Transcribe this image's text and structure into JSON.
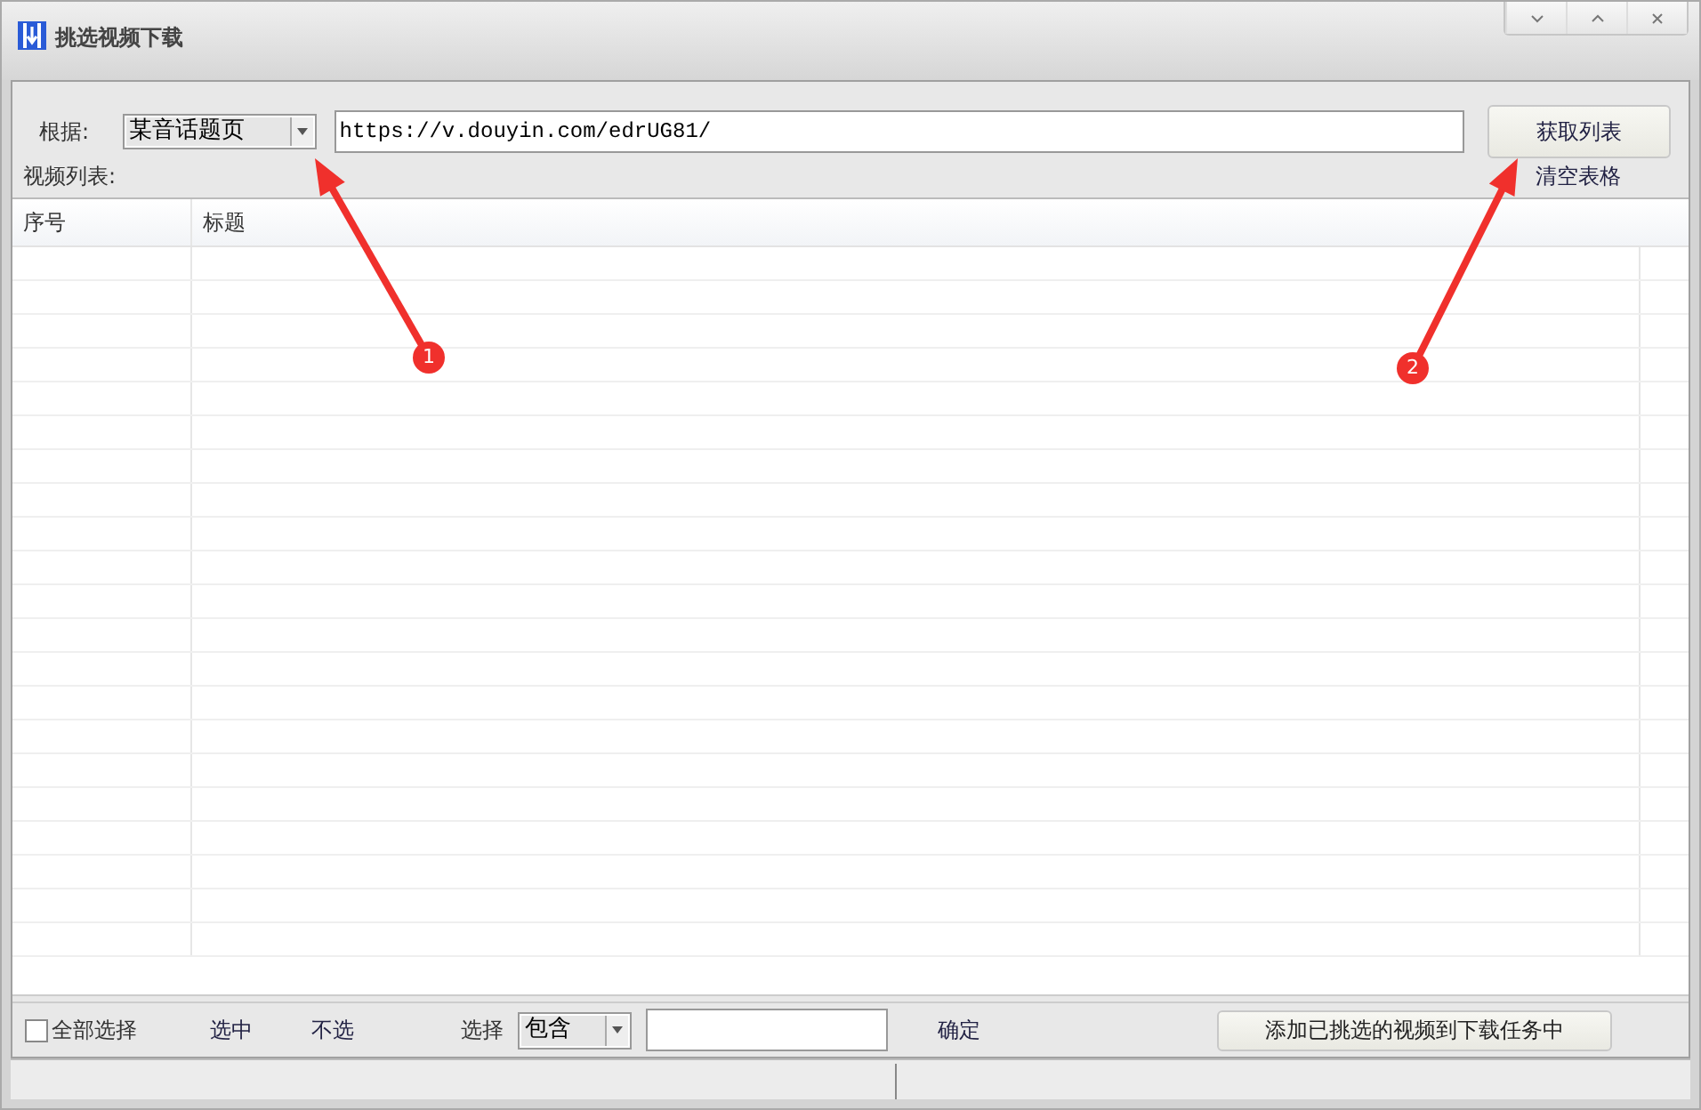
{
  "window": {
    "title": "挑选视频下载"
  },
  "source": {
    "label": "根据:",
    "mode": "某音话题页",
    "url": "https://v.douyin.com/edrUG81/",
    "fetch_button": "获取列表"
  },
  "list_label": "视频列表:",
  "clear_link": "清空表格",
  "table": {
    "columns": [
      "序号",
      "标题"
    ]
  },
  "footer": {
    "select_all": {
      "label": "全部选择",
      "checked": false
    },
    "select_link": "选中",
    "deselect_link": "不选",
    "filter_label": "选择",
    "filter_mode": "包含",
    "confirm": "确定",
    "add_button": "添加已挑选的视频到下载任务中"
  },
  "annotations": [
    {
      "number": "1"
    },
    {
      "number": "2"
    }
  ]
}
